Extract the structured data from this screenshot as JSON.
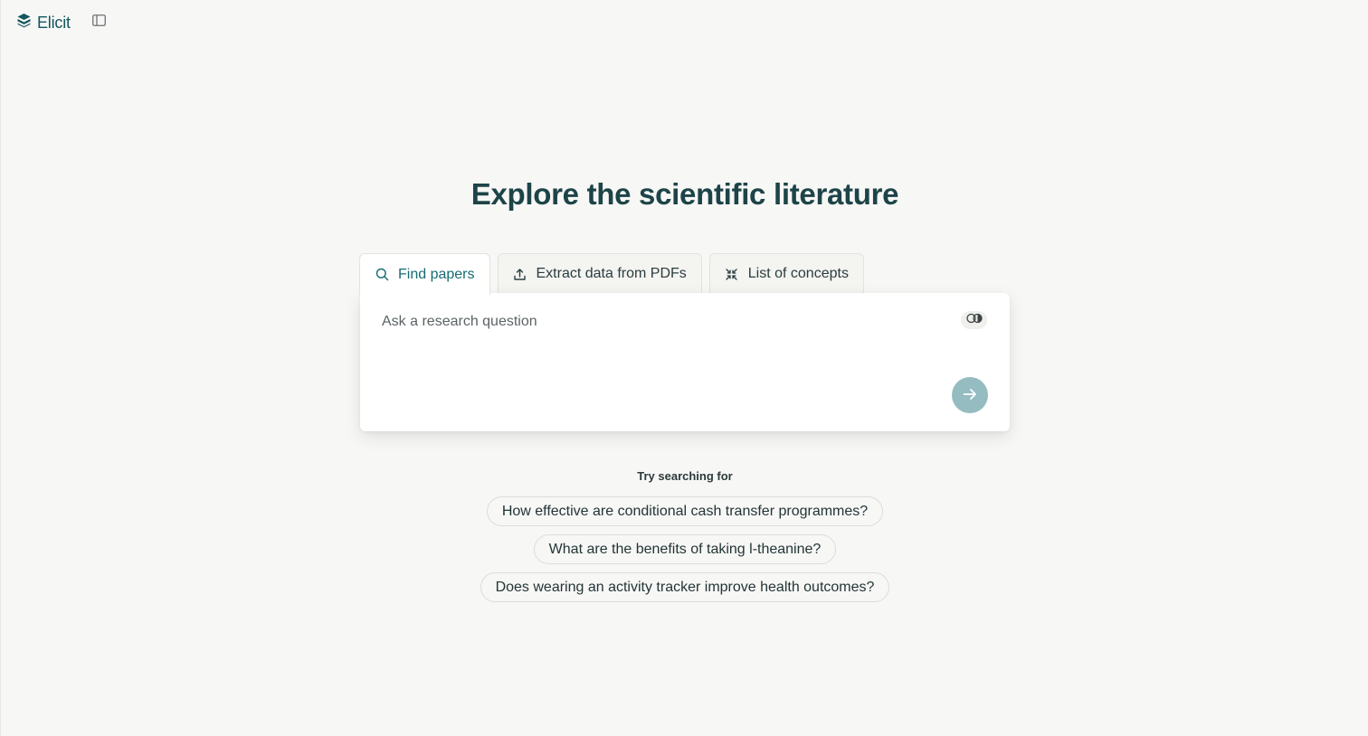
{
  "app": {
    "name": "Elicit",
    "accent_color": "#13565d"
  },
  "hero": {
    "title": "Explore the scientific literature"
  },
  "tabs": [
    {
      "label": "Find papers",
      "icon": "search-icon",
      "active": true
    },
    {
      "label": "Extract data from PDFs",
      "icon": "upload-icon",
      "active": false
    },
    {
      "label": "List of concepts",
      "icon": "collapse-arrows-icon",
      "active": false
    }
  ],
  "search": {
    "placeholder": "Ask a research question",
    "value": ""
  },
  "suggestions": {
    "title": "Try searching for",
    "items": [
      "How effective are conditional cash transfer programmes?",
      "What are the benefits of taking l-theanine?",
      "Does wearing an activity tracker improve health outcomes?"
    ]
  }
}
